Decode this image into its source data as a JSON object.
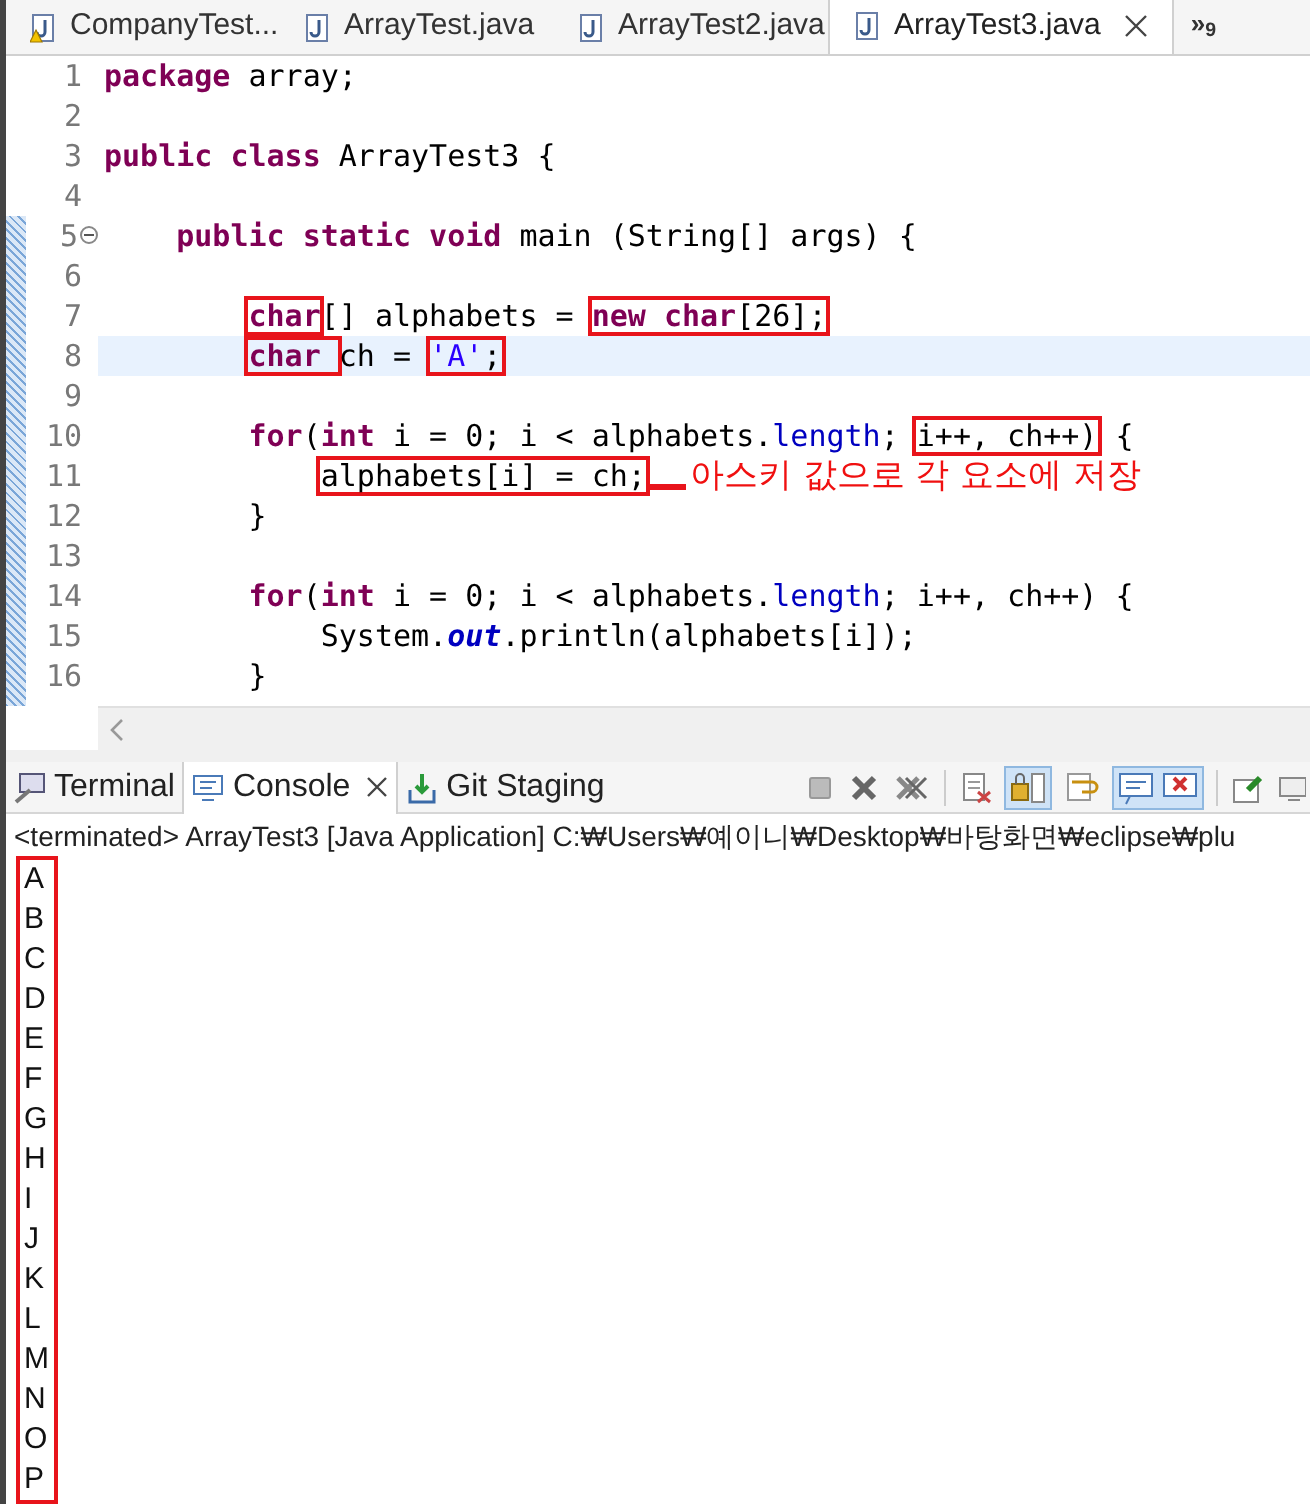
{
  "editor_tabs": [
    {
      "label": "CompanyTest...",
      "kind": "warning",
      "selected": false
    },
    {
      "label": "ArrayTest.java",
      "kind": "java",
      "selected": false
    },
    {
      "label": "ArrayTest2.java",
      "kind": "java",
      "selected": false
    },
    {
      "label": "ArrayTest3.java",
      "kind": "java",
      "selected": true
    }
  ],
  "overflow": "»$_{9}$",
  "editor": {
    "lines": [
      {
        "number": "1",
        "current": false,
        "fold": false,
        "segments": [
          {
            "boxed": false,
            "tokens": [
              {
                "text": "package",
                "kind": "keyword"
              },
              {
                "text": " array;",
                "kind": "plain"
              }
            ]
          }
        ]
      },
      {
        "number": "2",
        "current": false,
        "fold": false
      },
      {
        "number": "3",
        "current": false,
        "fold": false,
        "segments": [
          {
            "boxed": false,
            "tokens": [
              {
                "text": "public class",
                "kind": "keyword"
              },
              {
                "text": " ArrayTest3 {",
                "kind": "plain"
              }
            ]
          }
        ]
      },
      {
        "number": "4",
        "current": false,
        "fold": false
      },
      {
        "number": "5",
        "current": false,
        "fold": true,
        "segments": [
          {
            "boxed": false,
            "tokens": [
              {
                "text": "    public static void",
                "kind": "keyword"
              },
              {
                "text": " main (String[] args) {",
                "kind": "plain"
              }
            ]
          }
        ]
      },
      {
        "number": "6",
        "current": false,
        "fold": false
      },
      {
        "number": "7",
        "current": false,
        "fold": false,
        "segments": [
          {
            "boxed": true,
            "tokens": [
              {
                "text": "        char",
                "kind": "keyword"
              }
            ]
          },
          {
            "boxed": false,
            "tokens": [
              {
                "text": "[] alphabets = ",
                "kind": "plain"
              }
            ]
          },
          {
            "boxed": true,
            "tokens": [
              {
                "text": "new char",
                "kind": "keyword"
              },
              {
                "text": "[26];",
                "kind": "plain"
              }
            ]
          }
        ]
      },
      {
        "number": "8",
        "current": true,
        "fold": false,
        "segments": [
          {
            "boxed": true,
            "tokens": [
              {
                "text": "        char ",
                "kind": "keyword"
              }
            ]
          },
          {
            "boxed": false,
            "tokens": [
              {
                "text": "ch = ",
                "kind": "plain"
              }
            ]
          },
          {
            "boxed": true,
            "tokens": [
              {
                "text": "'A'",
                "kind": "string"
              },
              {
                "text": ";",
                "kind": "plain"
              }
            ]
          }
        ]
      },
      {
        "number": "9",
        "current": false,
        "fold": false
      },
      {
        "number": "10",
        "current": false,
        "fold": false,
        "segments": [
          {
            "boxed": false,
            "tokens": [
              {
                "text": "        for",
                "kind": "keyword"
              },
              {
                "text": "(",
                "kind": "plain"
              },
              {
                "text": "int",
                "kind": "keyword"
              },
              {
                "text": " i = 0; i < alphabets.",
                "kind": "plain"
              },
              {
                "text": "length",
                "kind": "field"
              },
              {
                "text": "; ",
                "kind": "plain"
              }
            ]
          },
          {
            "boxed": true,
            "tokens": [
              {
                "text": "i++, ch++)",
                "kind": "plain"
              }
            ]
          },
          {
            "boxed": false,
            "tokens": [
              {
                "text": " {",
                "kind": "plain"
              }
            ]
          }
        ]
      },
      {
        "number": "11",
        "current": false,
        "fold": false,
        "note": "아스키 값으로 각 요소에 저장",
        "segments": [
          {
            "boxed": true,
            "tokens": [
              {
                "text": "            alphabets[i] = ch;",
                "kind": "plain"
              }
            ]
          }
        ]
      },
      {
        "number": "12",
        "current": false,
        "fold": false,
        "segments": [
          {
            "boxed": false,
            "tokens": [
              {
                "text": "        }",
                "kind": "plain"
              }
            ]
          }
        ]
      },
      {
        "number": "13",
        "current": false,
        "fold": false
      },
      {
        "number": "14",
        "current": false,
        "fold": false,
        "segments": [
          {
            "boxed": false,
            "tokens": [
              {
                "text": "        for",
                "kind": "keyword"
              },
              {
                "text": "(",
                "kind": "plain"
              },
              {
                "text": "int",
                "kind": "keyword"
              },
              {
                "text": " i = 0; i < alphabets.",
                "kind": "plain"
              },
              {
                "text": "length",
                "kind": "field"
              },
              {
                "text": "; i++, ch++) {",
                "kind": "plain"
              }
            ]
          }
        ]
      },
      {
        "number": "15",
        "current": false,
        "fold": false,
        "segments": [
          {
            "boxed": false,
            "tokens": [
              {
                "text": "            System.",
                "kind": "plain"
              },
              {
                "text": "out",
                "kind": "static"
              },
              {
                "text": ".println(alphabets[i]);",
                "kind": "plain"
              }
            ]
          }
        ]
      },
      {
        "number": "16",
        "current": false,
        "fold": false,
        "segments": [
          {
            "boxed": false,
            "tokens": [
              {
                "text": "        }",
                "kind": "plain"
              }
            ]
          }
        ]
      }
    ]
  },
  "panel_tabs": [
    {
      "label": "Terminal",
      "kind": "terminal",
      "selected": false
    },
    {
      "label": "Console",
      "kind": "console",
      "selected": true
    },
    {
      "label": "Git Staging",
      "kind": "git",
      "selected": false
    }
  ],
  "console": {
    "status": "<terminated> ArrayTest3 [Java Application] C:₩Users₩예이니₩Desktop₩바탕화면₩eclipse₩plu",
    "boxed": true,
    "output": [
      "A",
      "B",
      "C",
      "D",
      "E",
      "F",
      "G",
      "H",
      "I",
      "J",
      "K",
      "L",
      "M",
      "N",
      "O",
      "P"
    ]
  }
}
